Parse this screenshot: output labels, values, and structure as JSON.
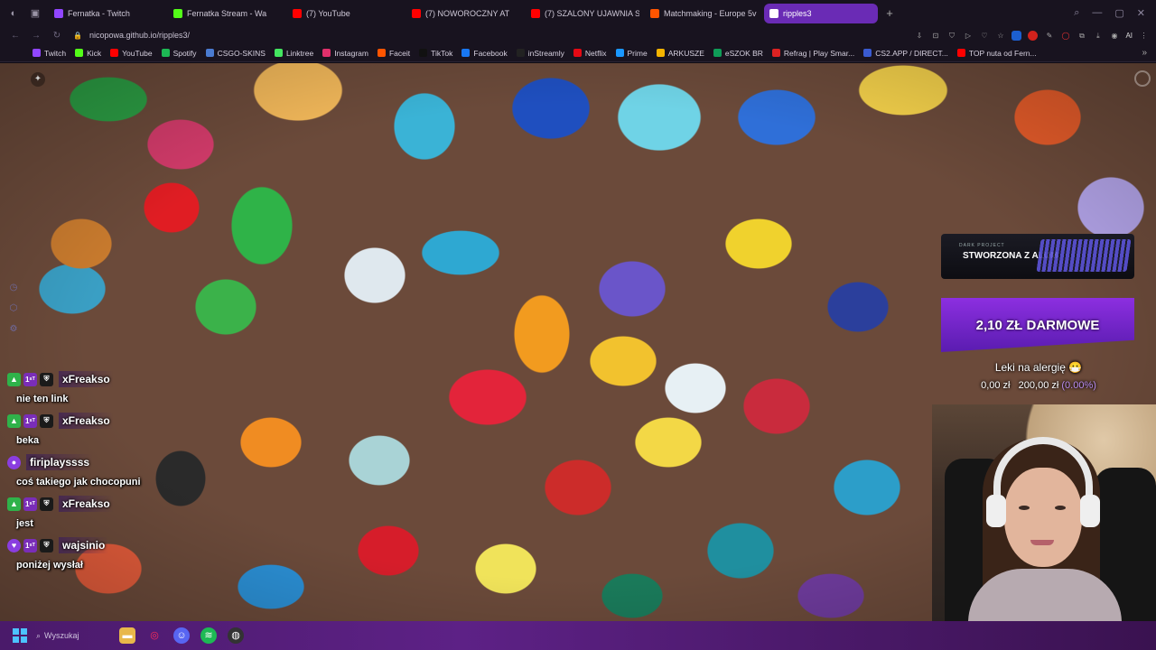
{
  "tabs": [
    {
      "label": "Fernatka - Twitch",
      "color": "#9146ff"
    },
    {
      "label": "Fernatka Stream - Wa",
      "color": "#53fc18"
    },
    {
      "label": "(7) YouTube",
      "color": "#ff0000"
    },
    {
      "label": "(7) NOWOROCZNY AT",
      "color": "#ff0000"
    },
    {
      "label": "(7) SZALONY UJAWNIA S",
      "color": "#ff0000"
    },
    {
      "label": "Matchmaking - Europe 5v",
      "color": "#ff5500"
    },
    {
      "label": "ripples3",
      "color": "#ffffff",
      "active": true
    }
  ],
  "address": {
    "url": "nicopowa.github.io/ripples3/"
  },
  "extensions": {
    "ai_label": "AI"
  },
  "bookmarks": [
    {
      "label": "Twitch",
      "color": "#9146ff"
    },
    {
      "label": "Kick",
      "color": "#53fc18"
    },
    {
      "label": "YouTube",
      "color": "#ff0000"
    },
    {
      "label": "Spotify",
      "color": "#1db954"
    },
    {
      "label": "CSGO-SKINS",
      "color": "#4a7bd1"
    },
    {
      "label": "Linktree",
      "color": "#43e660"
    },
    {
      "label": "Instagram",
      "color": "#e1306c"
    },
    {
      "label": "Faceit",
      "color": "#ff5500"
    },
    {
      "label": "TikTok",
      "color": "#111111"
    },
    {
      "label": "Facebook",
      "color": "#1877f2"
    },
    {
      "label": "inStreamly",
      "color": "#222222"
    },
    {
      "label": "Netflix",
      "color": "#e50914"
    },
    {
      "label": "Prime",
      "color": "#1a98ff"
    },
    {
      "label": "ARKUSZE",
      "color": "#f4b400"
    },
    {
      "label": "eSZOK BR",
      "color": "#0f9d58"
    },
    {
      "label": "Refrag | Play Smar...",
      "color": "#d22"
    },
    {
      "label": "CS2.APP / DIRECT...",
      "color": "#3a5bd1"
    },
    {
      "label": "TOP nuta od Fern...",
      "color": "#ff0000"
    }
  ],
  "chat": [
    {
      "user": "xFreakso",
      "text": "nie ten link",
      "badges": [
        "green",
        "gold",
        "rank"
      ],
      "badge_labels": [
        "▲",
        "1ˢᵀ",
        "⛨"
      ]
    },
    {
      "user": "xFreakso",
      "text": "beka",
      "badges": [
        "green",
        "gold",
        "rank"
      ],
      "badge_labels": [
        "▲",
        "1ˢᵀ",
        "⛨"
      ]
    },
    {
      "user": "firiplayssss",
      "text": "coś takiego jak chocopuni",
      "badges": [
        "purple"
      ],
      "badge_labels": [
        "●"
      ]
    },
    {
      "user": "xFreakso",
      "text": "jest",
      "badges": [
        "green",
        "gold",
        "rank"
      ],
      "badge_labels": [
        "▲",
        "1ˢᵀ",
        "⛨"
      ]
    },
    {
      "user": "wajsinio",
      "text": "poniżej wysłał",
      "badges": [
        "purple",
        "gold",
        "rank"
      ],
      "badge_labels": [
        "♥",
        "1ˢᵀ",
        "⛨"
      ]
    }
  ],
  "promo": {
    "text": "STWORZONA Z ALUM",
    "brand": "DARK PROJECT"
  },
  "goal": {
    "label": "2,10 ZŁ DARMOWE"
  },
  "alert": {
    "title": "Leki na alergię 😷",
    "amount_current": "0,00 zł",
    "amount_target": "200,00 zł",
    "percent": "(0.00%)",
    "progress": 0.0
  },
  "taskbar": {
    "search_label": "Wyszukaj"
  }
}
